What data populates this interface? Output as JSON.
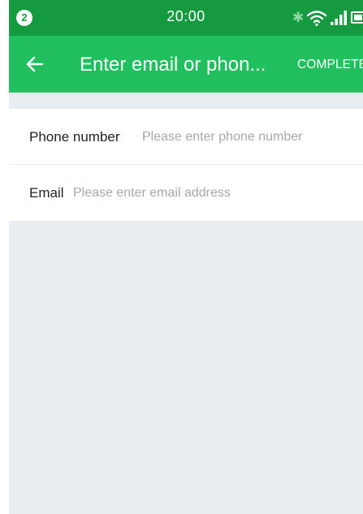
{
  "status_bar": {
    "notification_count": "2",
    "time": "20:00",
    "icons": [
      "bluetooth-icon",
      "wifi-icon",
      "signal-icon",
      "battery-icon"
    ]
  },
  "app_bar": {
    "back_icon": "arrow-left-icon",
    "title": "Enter email or phon...",
    "complete_label": "COMPLETE"
  },
  "form": {
    "phone": {
      "label": "Phone number",
      "value": "",
      "placeholder": "Please enter phone number"
    },
    "email": {
      "label": "Email",
      "value": "",
      "placeholder": "Please enter email address"
    }
  },
  "colors": {
    "status_bar": "#159a3f",
    "app_bar": "#22bf5e",
    "background": "#e9edf2",
    "placeholder": "#a5a8ab"
  }
}
